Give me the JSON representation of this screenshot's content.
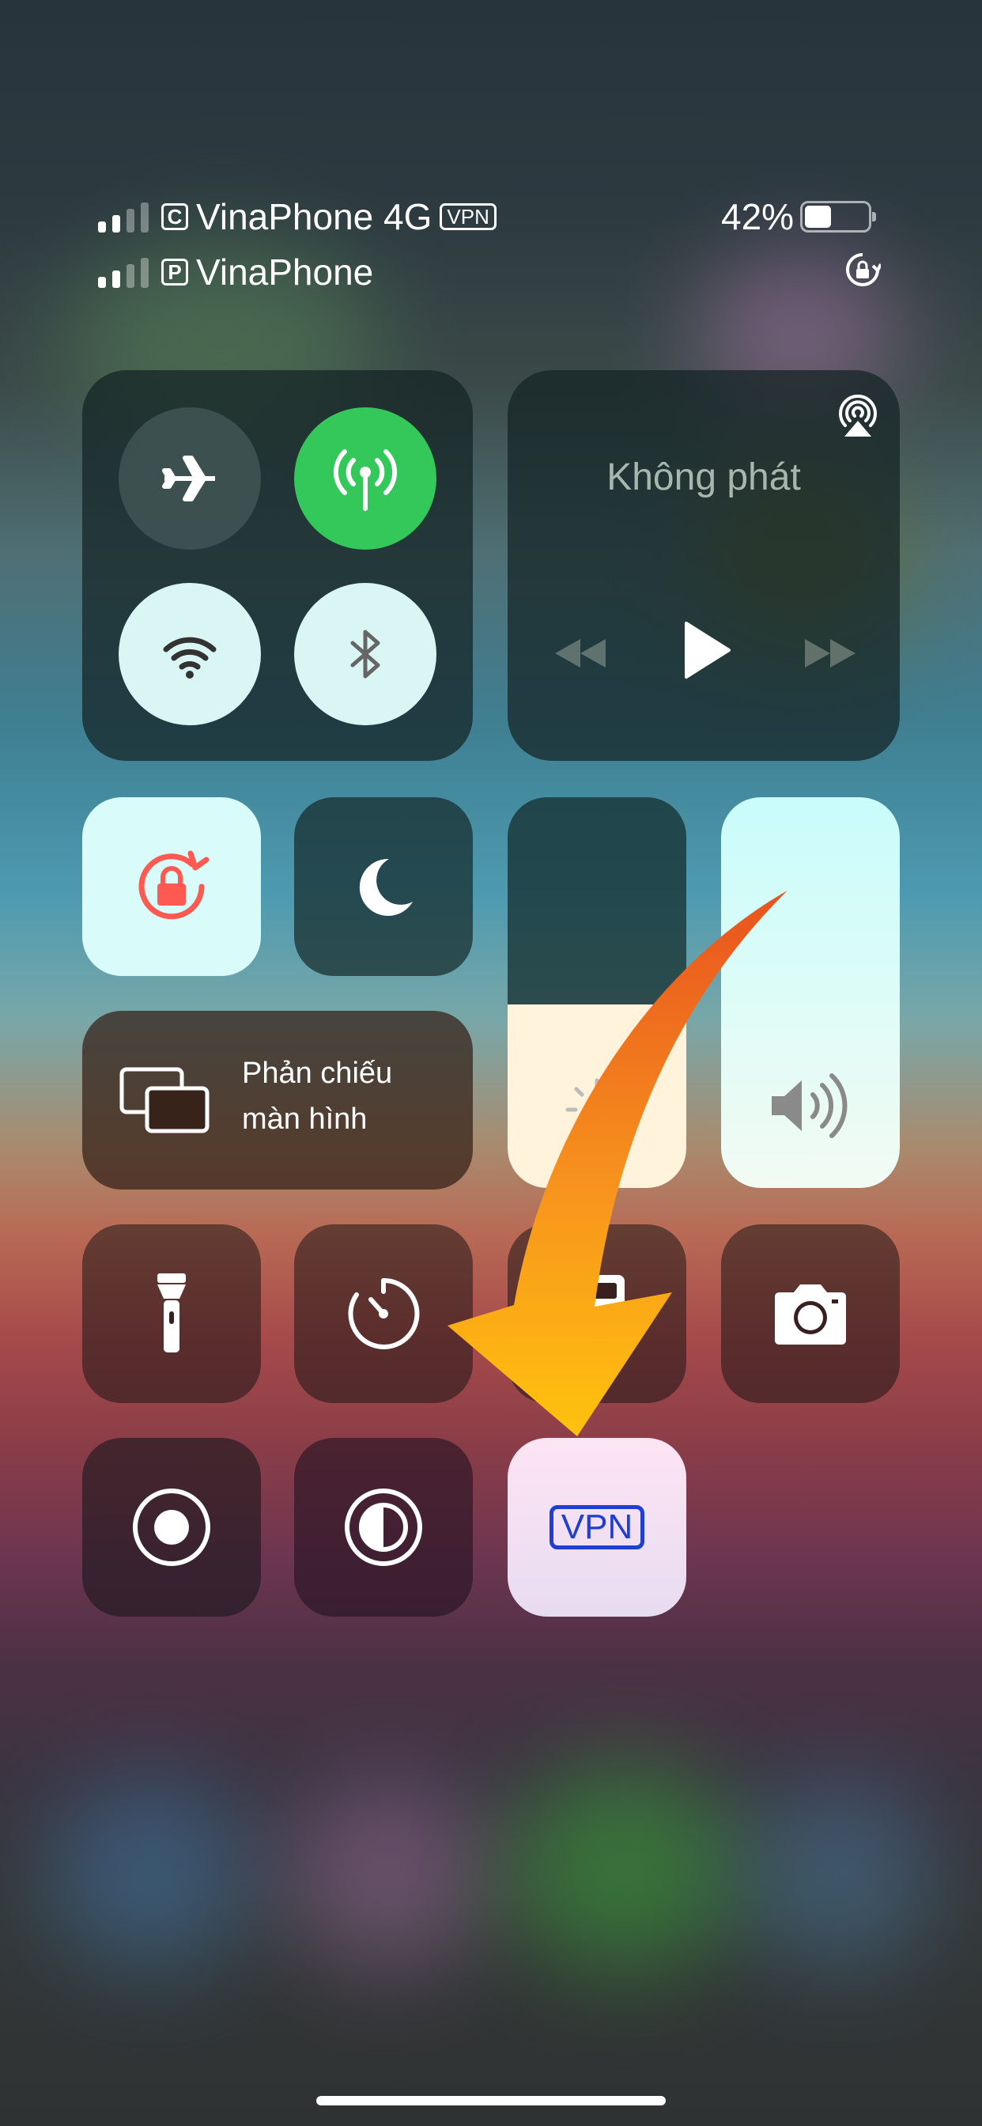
{
  "status_bar": {
    "carrier_primary": "VinaPhone 4G",
    "carrier_primary_tag": "C",
    "vpn_badge": "VPN",
    "carrier_secondary": "VinaPhone",
    "carrier_secondary_tag": "P",
    "battery_percent": "42%",
    "battery_level": 0.42
  },
  "now_playing": {
    "title": "Không phát"
  },
  "screen_mirroring": {
    "label_line1": "Phản chiếu",
    "label_line2": "màn hình"
  },
  "sliders": {
    "brightness_level": 0.47,
    "volume_level": 1.0
  },
  "vpn_tile": {
    "label": "VPN"
  },
  "connectivity": {
    "airplane_mode": false,
    "cellular_data": true,
    "wifi": true,
    "bluetooth": true
  },
  "colors": {
    "cellular_green": "#34c759",
    "vpn_blue": "#1f3fd1",
    "rotation_lock_red": "#ff3b30",
    "arrow_orange": "#f7941d"
  },
  "icons": [
    "airplane-icon",
    "cellular-icon",
    "wifi-icon",
    "bluetooth-icon",
    "airplay-icon",
    "rewind-icon",
    "play-icon",
    "fast-forward-icon",
    "rotation-lock-icon",
    "moon-icon",
    "screen-mirroring-icon",
    "brightness-icon",
    "volume-icon",
    "flashlight-icon",
    "timer-icon",
    "calculator-icon",
    "camera-icon",
    "screen-record-icon",
    "dark-mode-icon"
  ]
}
